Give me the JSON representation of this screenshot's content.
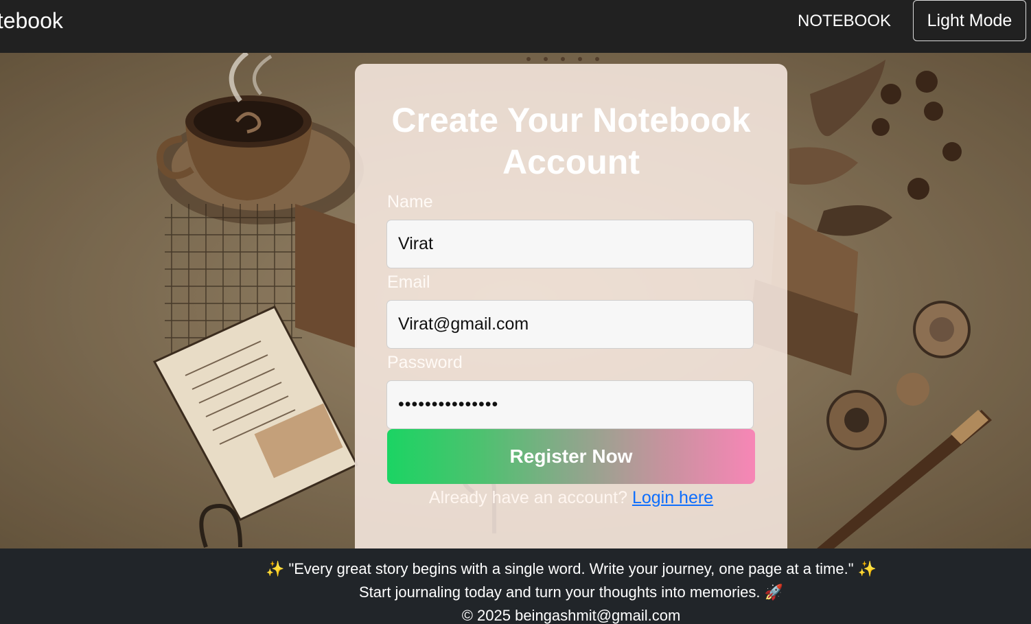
{
  "navbar": {
    "brand": "otebook",
    "link": "NOTEBOOK",
    "mode_button": "Light Mode"
  },
  "form": {
    "title": "Create Your Notebook Account",
    "name_label": "Name",
    "name_value": "Virat",
    "email_label": "Email",
    "email_value": "Virat@gmail.com",
    "password_label": "Password",
    "password_value": "•••••••••••••••",
    "submit_label": "Register Now",
    "login_prompt": "Already have an account?",
    "login_link": "Login here"
  },
  "footer": {
    "quote": "✨ \"Every great story begins with a single word. Write your journey, one page at a time.\" ✨",
    "tagline": "Start journaling today and turn your thoughts into memories. 🚀",
    "copyright": "© 2025 beingashmit@gmail.com"
  },
  "colors": {
    "navbar_bg": "#212121",
    "footer_bg": "#212529",
    "gradient_start": "#1bd463",
    "gradient_end": "#f786b6",
    "link": "#0d6efd"
  }
}
